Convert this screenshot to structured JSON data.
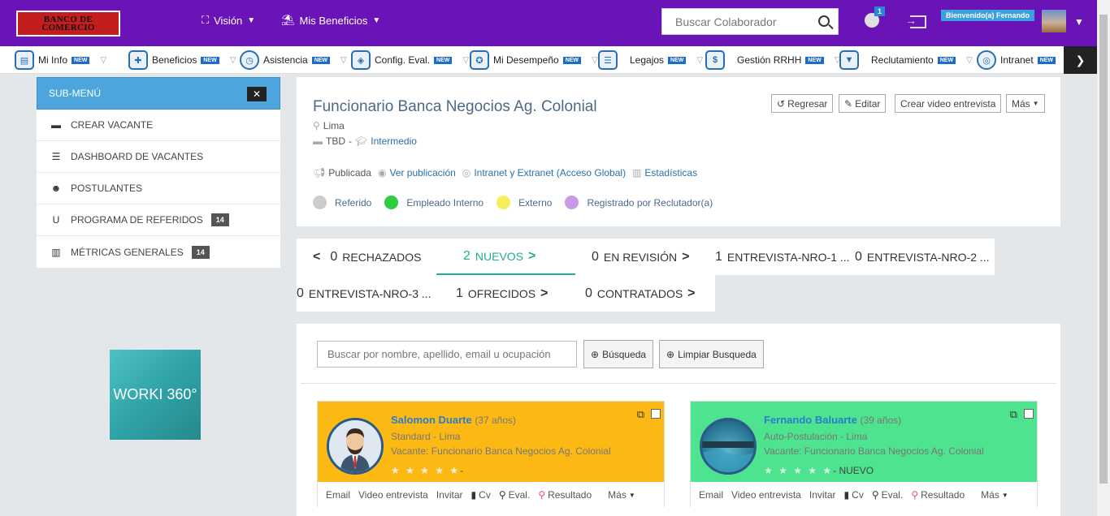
{
  "topbar": {
    "logo_line1": "BANCO DE",
    "logo_line2": "COMERCIO",
    "nav_vision": "Visión",
    "nav_beneficios": "Mis Beneficios",
    "search_placeholder": "Buscar Colaborador",
    "notif_count": "1",
    "welcome": "Bienvenido(a) Fernando",
    "bg_color": "#6a14b8"
  },
  "modules": [
    {
      "label": "Mi Info",
      "badge": "NEW"
    },
    {
      "label": "Beneficios",
      "badge": "NEW"
    },
    {
      "label": "Asistencia",
      "badge": "NEW"
    },
    {
      "label": "Config. Eval.",
      "badge": "NEW"
    },
    {
      "label": "Mi Desempeño",
      "badge": "NEW"
    },
    {
      "label": "Legajos",
      "badge": "NEW"
    },
    {
      "label": "Gestión RRHH",
      "badge": "NEW"
    },
    {
      "label": "Reclutamiento",
      "badge": "NEW"
    },
    {
      "label": "Intranet",
      "badge": "NEW"
    }
  ],
  "submenu": {
    "title": "SUB-MENÚ",
    "items": [
      {
        "label": "CREAR VACANTE",
        "count": ""
      },
      {
        "label": "DASHBOARD DE VACANTES",
        "count": ""
      },
      {
        "label": "POSTULANTES",
        "count": ""
      },
      {
        "label": "PROGRAMA DE REFERIDOS",
        "count": "14"
      },
      {
        "label": "MÉTRICAS GENERALES",
        "count": "14"
      }
    ],
    "worki_label": "WORKI 360°"
  },
  "job": {
    "title": "Funcionario Banca Negocios Ag. Colonial",
    "location": "Lima",
    "salary": "TBD",
    "level": "Intermedio",
    "status": "Publicada",
    "view_link": "Ver publicación",
    "scope": "Intranet y Extranet (Acceso Global)",
    "stats_link": "Estadísticas",
    "buttons": {
      "back": "Regresar",
      "edit": "Editar",
      "video": "Crear video entrevista",
      "more": "Más"
    },
    "legend": [
      {
        "label": "Referido",
        "color": "#cccccc"
      },
      {
        "label": "Empleado Interno",
        "color": "#2ecc40"
      },
      {
        "label": "Externo",
        "color": "#f5f05a"
      },
      {
        "label": "Registrado por Reclutador(a)",
        "color": "#c89ae8"
      }
    ]
  },
  "stages": [
    {
      "num": "0",
      "label": "RECHAZADOS"
    },
    {
      "num": "2",
      "label": "NUEVOS"
    },
    {
      "num": "0",
      "label": "EN REVISIÓN"
    },
    {
      "num": "1",
      "label": "ENTREVISTA-NRO-1 ..."
    },
    {
      "num": "0",
      "label": "ENTREVISTA-NRO-2 ..."
    },
    {
      "num": "0",
      "label": "ENTREVISTA-NRO-3 ..."
    },
    {
      "num": "1",
      "label": "OFRECIDOS"
    },
    {
      "num": "0",
      "label": "CONTRATADOS"
    }
  ],
  "search": {
    "placeholder": "Buscar por nombre, apellido, email u ocupación",
    "search_btn": "Búsqueda",
    "clear_btn": "Limpiar Busqueda"
  },
  "candidates": [
    {
      "name": "Salomon Duarte",
      "age": "(37 años)",
      "sub1": "Standard - Lima",
      "sub2": "Vacante: Funcionario Banca Negocios Ag. Colonial",
      "stars": "★ ★ ★ ★ ★",
      "tag": "-",
      "color": "#fdb913"
    },
    {
      "name": "Fernando Baluarte",
      "age": "(39 años)",
      "sub1": "Auto-Postulación - Lima",
      "sub2": "Vacante: Funcionario Banca Negocios Ag. Colonial",
      "stars": "★ ★ ★ ★ ★",
      "tag": "- NUEVO",
      "color": "#4de38f"
    }
  ],
  "candidate_actions": {
    "email": "Email",
    "video": "Video entrevista",
    "invite": "Invitar",
    "cv": "Cv",
    "eval": "Eval.",
    "result": "Resultado",
    "more": "Más"
  }
}
